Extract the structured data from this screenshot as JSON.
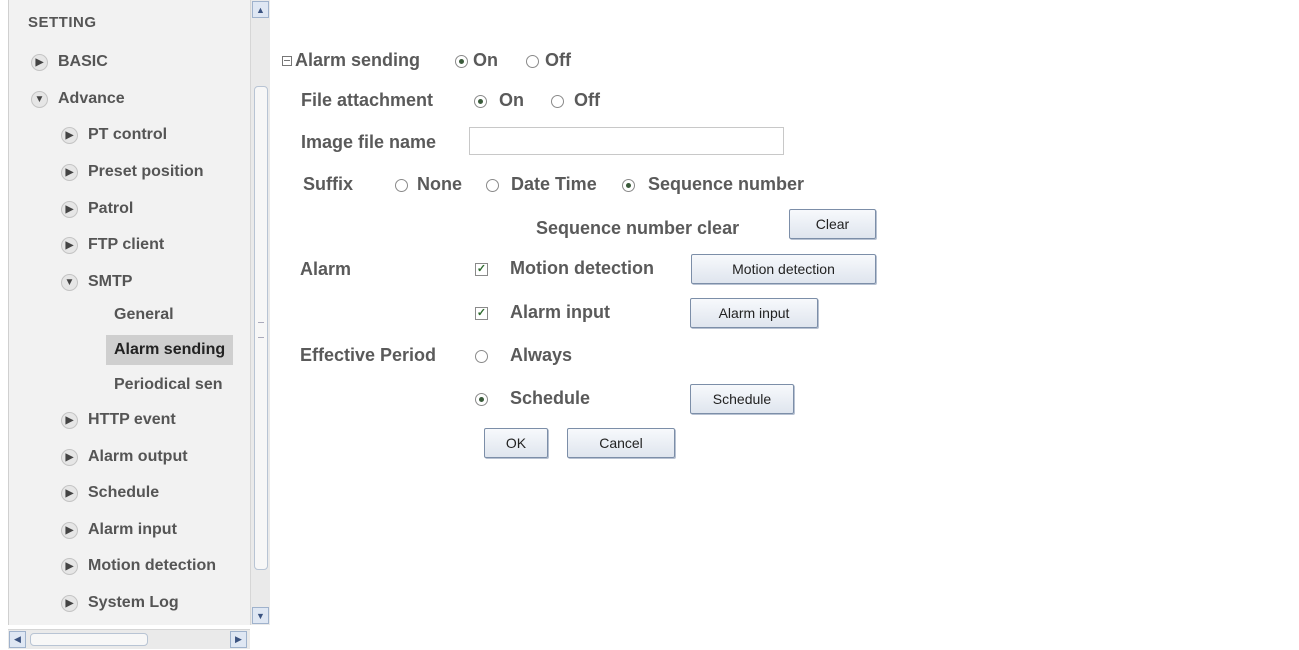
{
  "sidebar": {
    "heading": "SETTING",
    "items": [
      {
        "label": "BASIC",
        "state": "collapsed"
      },
      {
        "label": "Advance",
        "state": "expanded"
      },
      {
        "label": "PT control",
        "state": "collapsed"
      },
      {
        "label": "Preset position",
        "state": "collapsed"
      },
      {
        "label": "Patrol",
        "state": "collapsed"
      },
      {
        "label": "FTP client",
        "state": "collapsed"
      },
      {
        "label": "SMTP",
        "state": "expanded"
      },
      {
        "label": "HTTP event",
        "state": "collapsed"
      },
      {
        "label": "Alarm output",
        "state": "collapsed"
      },
      {
        "label": "Schedule",
        "state": "collapsed"
      },
      {
        "label": "Alarm input",
        "state": "collapsed"
      },
      {
        "label": "Motion detection",
        "state": "collapsed"
      },
      {
        "label": "System Log",
        "state": "collapsed"
      }
    ],
    "smtp_subitems": [
      {
        "label": "General",
        "active": false
      },
      {
        "label": "Alarm sending",
        "active": true
      },
      {
        "label": "Periodical sen",
        "active": false
      }
    ]
  },
  "form": {
    "alarm_sending": {
      "label": "Alarm sending",
      "on_label": "On",
      "off_label": "Off",
      "value": "On"
    },
    "file_attachment": {
      "label": "File attachment",
      "on_label": "On",
      "off_label": "Off",
      "value": "On"
    },
    "image_file_name": {
      "label": "Image file name",
      "value": ""
    },
    "suffix": {
      "label": "Suffix",
      "options": [
        "None",
        "Date Time",
        "Sequence number"
      ],
      "value": "Sequence number"
    },
    "sequence_clear": {
      "label": "Sequence number clear",
      "button": "Clear"
    },
    "alarm": {
      "label": "Alarm",
      "motion_detection": {
        "label": "Motion detection",
        "checked": true,
        "button": "Motion detection"
      },
      "alarm_input": {
        "label": "Alarm input",
        "checked": true,
        "button": "Alarm input"
      }
    },
    "effective_period": {
      "label": "Effective Period",
      "always_label": "Always",
      "schedule_label": "Schedule",
      "value": "Schedule",
      "schedule_button": "Schedule"
    },
    "ok_button": "OK",
    "cancel_button": "Cancel"
  },
  "colors": {
    "sidebar_bg": "#f2f2f2",
    "active_item_bg": "#cfcfcf",
    "button_border": "#7c8ea8"
  }
}
